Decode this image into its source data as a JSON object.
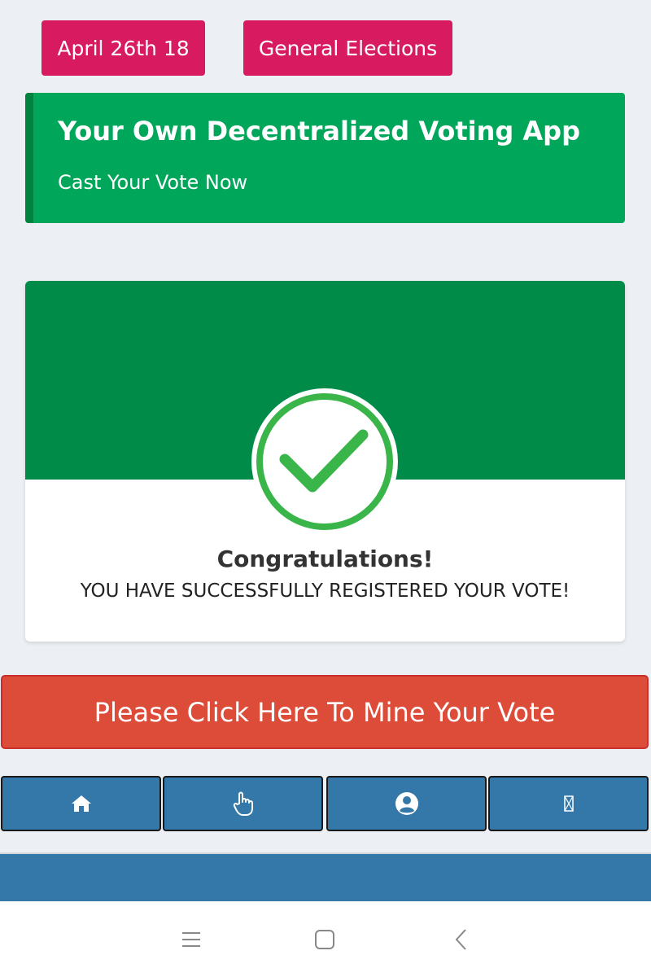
{
  "top_buttons": {
    "date_label": "April 26th 18",
    "election_label": "General Elections"
  },
  "banner": {
    "title": "Your Own Decentralized Voting App",
    "subtitle": "Cast Your Vote Now"
  },
  "success_card": {
    "heading": "Congratulations!",
    "message": "YOU HAVE SUCCESSFULLY REGISTERED YOUR VOTE!",
    "icon": "check-circle-icon"
  },
  "mine_button": {
    "label": "Please Click Here To Mine Your Vote"
  },
  "bottom_nav": {
    "items": [
      {
        "icon": "home-icon"
      },
      {
        "icon": "pointer-hand-icon"
      },
      {
        "icon": "user-circle-icon"
      },
      {
        "icon": "missing-glyph-icon"
      }
    ]
  },
  "system_nav": {
    "items": [
      "menu-icon",
      "home-square-icon",
      "back-chevron-icon"
    ]
  },
  "colors": {
    "background": "#eceff3",
    "tag": "#d81b60",
    "banner": "#00a65a",
    "card_header": "#008c48",
    "check": "#3ab54a",
    "danger": "#dd4b39",
    "nav": "#3378a8"
  }
}
